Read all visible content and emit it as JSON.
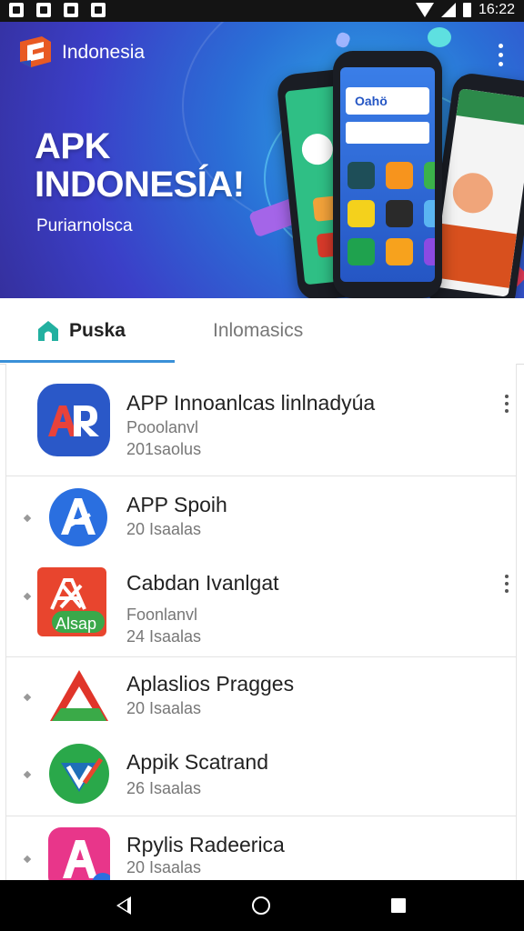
{
  "status_bar": {
    "time": "16:22"
  },
  "hero": {
    "brand": "Indonesia",
    "title_line1": "APK",
    "title_line2": "INDONESÍA!",
    "subtitle": "Puriarnolsca",
    "phone_banner": "Oahö"
  },
  "tabs": [
    {
      "label": "Puska",
      "selected": true
    },
    {
      "label": "Inlomasics",
      "selected": false
    }
  ],
  "apps": [
    {
      "name": "APP Innoanlcas linlnadyúa",
      "line2": "Pooolanvl",
      "line3": "201saolus",
      "icon": "apk-blue-icon",
      "has_menu": true
    },
    {
      "name": "APP Spoih",
      "line2": "20 Isaalas",
      "icon": "a-blue-circle-icon",
      "has_menu": false
    },
    {
      "name": "Cabdan Ivanlgat",
      "line2": "Foonlanvl",
      "line3": "24 Isaalas",
      "badge": "Alsap",
      "icon": "red-robot-icon",
      "has_menu": true
    },
    {
      "name": "Aplaslios Pragges",
      "line2": "20 Isaalas",
      "icon": "red-green-triangle-icon",
      "has_menu": false
    },
    {
      "name": "Appik Scatrand",
      "line2": "26 Isaalas",
      "icon": "green-circle-icon",
      "has_menu": false
    },
    {
      "name": "Rpylis Radeerica",
      "line2": "20 Isaalas",
      "icon": "pink-a-icon",
      "has_menu": false
    }
  ],
  "colors": {
    "tab_accent": "#3a90d8",
    "hero_blue": "#2a6fd6"
  }
}
